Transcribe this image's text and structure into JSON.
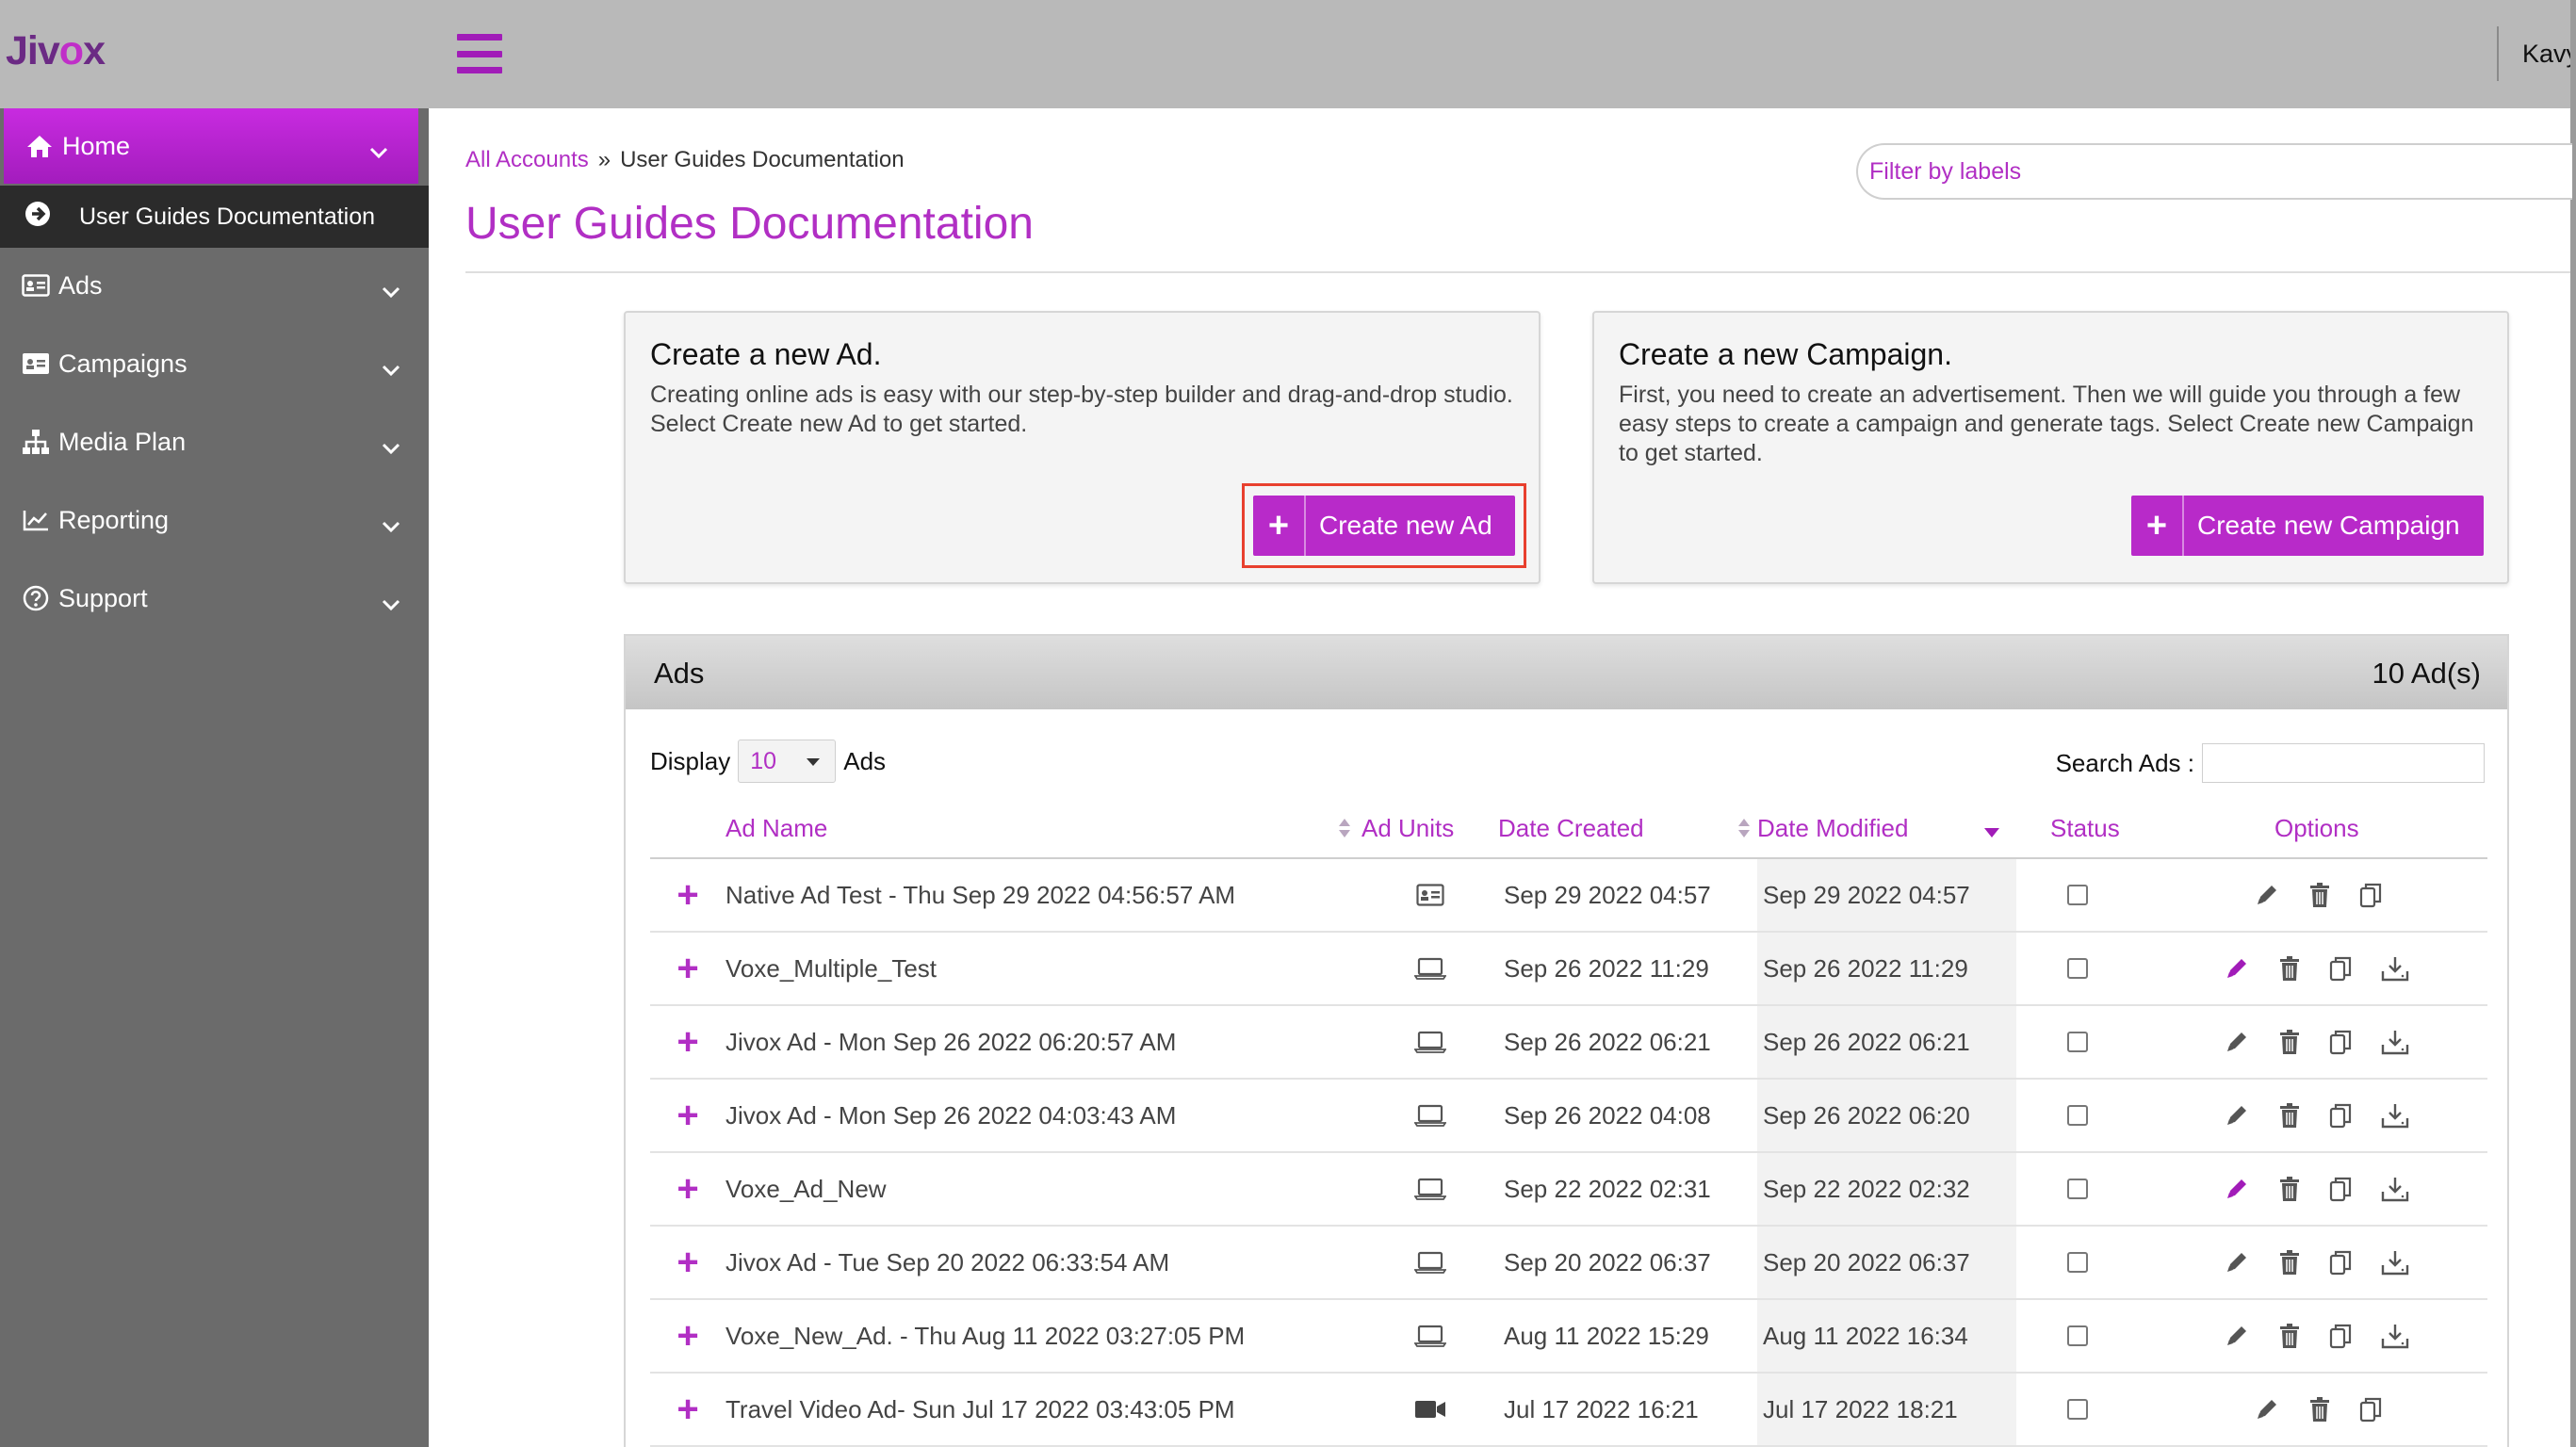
{
  "brand": {
    "logo_text_a": "Jiv",
    "logo_text_b": "o",
    "logo_text_c": "x",
    "accent": "#b12fc4",
    "accent_dark": "#a11cb8",
    "highlight_border": "#e8402e"
  },
  "header": {
    "user_name": "Kavy"
  },
  "sidebar": {
    "home": {
      "label": "Home",
      "icon": "home-icon"
    },
    "sub_item": {
      "label": "User Guides Documentation",
      "icon": "arrow-circle-right-icon"
    },
    "items": [
      {
        "label": "Ads",
        "icon": "id-card-icon"
      },
      {
        "label": "Campaigns",
        "icon": "id-card-icon"
      },
      {
        "label": "Media Plan",
        "icon": "sitemap-icon"
      },
      {
        "label": "Reporting",
        "icon": "line-chart-icon"
      },
      {
        "label": "Support",
        "icon": "help-circle-icon"
      }
    ]
  },
  "breadcrumb": {
    "root": "All Accounts",
    "separator": "»",
    "current": "User Guides Documentation"
  },
  "page_title": "User Guides Documentation",
  "filter": {
    "placeholder": "Filter by labels"
  },
  "card_ad": {
    "title": "Create a new Ad.",
    "description": "Creating online ads is easy with our step-by-step builder and drag-and-drop studio. Select Create new Ad to get started.",
    "button_label": "Create new Ad"
  },
  "card_campaign": {
    "title": "Create a new Campaign.",
    "description": "First, you need to create an advertisement. Then we will guide you through a few easy steps to create a campaign and generate tags. Select Create new Campaign to get started.",
    "button_label": "Create new Campaign"
  },
  "ads_panel": {
    "title": "Ads",
    "count": "10 Ad(s)",
    "display_label": "Display",
    "display_value": "10",
    "display_suffix": "Ads",
    "search_label": "Search Ads :",
    "columns": {
      "name": "Ad Name",
      "units": "Ad Units",
      "created": "Date Created",
      "modified": "Date Modified",
      "status": "Status",
      "options": "Options"
    },
    "rows": [
      {
        "name": "Native Ad Test - Thu Sep 29 2022 04:56:57 AM",
        "unit": "native",
        "created": "Sep 29 2022 04:57",
        "modified": "Sep 29 2022 04:57",
        "download": false,
        "edit_active": false
      },
      {
        "name": "Voxe_Multiple_Test",
        "unit": "display",
        "created": "Sep 26 2022 11:29",
        "modified": "Sep 26 2022 11:29",
        "download": true,
        "edit_active": true
      },
      {
        "name": "Jivox Ad - Mon Sep 26 2022 06:20:57 AM",
        "unit": "display",
        "created": "Sep 26 2022 06:21",
        "modified": "Sep 26 2022 06:21",
        "download": true,
        "edit_active": false
      },
      {
        "name": "Jivox Ad - Mon Sep 26 2022 04:03:43 AM",
        "unit": "display",
        "created": "Sep 26 2022 04:08",
        "modified": "Sep 26 2022 06:20",
        "download": true,
        "edit_active": false
      },
      {
        "name": "Voxe_Ad_New",
        "unit": "display",
        "created": "Sep 22 2022 02:31",
        "modified": "Sep 22 2022 02:32",
        "download": true,
        "edit_active": true
      },
      {
        "name": "Jivox Ad - Tue Sep 20 2022 06:33:54 AM",
        "unit": "display",
        "created": "Sep 20 2022 06:37",
        "modified": "Sep 20 2022 06:37",
        "download": true,
        "edit_active": false
      },
      {
        "name": "Voxe_New_Ad. - Thu Aug 11 2022 03:27:05 PM",
        "unit": "display",
        "created": "Aug 11 2022 15:29",
        "modified": "Aug 11 2022 16:34",
        "download": true,
        "edit_active": false
      },
      {
        "name": "Travel Video Ad- Sun Jul 17 2022 03:43:05 PM",
        "unit": "video",
        "created": "Jul 17 2022 16:21",
        "modified": "Jul 17 2022 18:21",
        "download": false,
        "edit_active": false
      }
    ]
  }
}
